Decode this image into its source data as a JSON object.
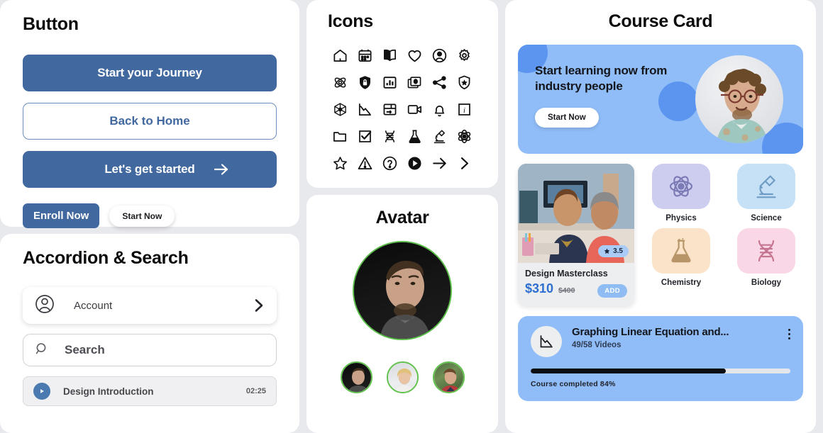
{
  "sections": {
    "button": {
      "title": "Button"
    },
    "icons": {
      "title": "Icons"
    },
    "avatar": {
      "title": "Avatar"
    },
    "accordion": {
      "title": "Accordion & Search"
    },
    "course": {
      "title": "Course Card"
    }
  },
  "buttons": {
    "primary": "Start your Journey",
    "outline": "Back to Home",
    "arrow": "Let's get started",
    "enroll": "Enroll Now",
    "start_now": "Start Now"
  },
  "accordion": {
    "account_label": "Account",
    "search_placeholder": "Search",
    "lesson_title": "Design Introduction",
    "lesson_time": "02:25"
  },
  "icon_names": [
    "home-icon",
    "calendar-icon",
    "book-icon",
    "heart-icon",
    "user-circle-icon",
    "gear-icon",
    "atom-icon",
    "shield-lock-icon",
    "bar-chart-icon",
    "card-stack-icon",
    "share-icon",
    "shield-star-icon",
    "network-node-icon",
    "line-chart-down-icon",
    "layout-arrow-icon",
    "video-camera-icon",
    "bell-icon",
    "info-icon",
    "folder-icon",
    "checkbox-checked-icon",
    "dna-icon",
    "flask-icon",
    "microscope-icon",
    "atom-orbit-icon",
    "star-icon",
    "warning-icon",
    "question-circle-icon",
    "play-circle-icon",
    "arrow-right-icon",
    "chevron-right-icon"
  ],
  "course": {
    "hero": {
      "title": "Start learning now from industry people",
      "cta": "Start Now"
    },
    "product": {
      "name": "Design Masterclass",
      "price": "$310",
      "old_price": "$400",
      "rating": "3.5",
      "add_label": "ADD"
    },
    "subjects": [
      {
        "label": "Physics",
        "icon": "atom-icon",
        "bg": "#cdcdf0",
        "stroke": "#7b7bb5"
      },
      {
        "label": "Science",
        "icon": "microscope-icon",
        "bg": "#c6e1f6",
        "stroke": "#6f9cc4"
      },
      {
        "label": "Chemistry",
        "icon": "flask-icon",
        "bg": "#fae3c8",
        "stroke": "#b79568"
      },
      {
        "label": "Biology",
        "icon": "dna-icon",
        "bg": "#fad7e6",
        "stroke": "#c4748f"
      }
    ],
    "progress": {
      "title": "Graphing Linear Equation and...",
      "videos": "49/58 Videos",
      "caption": "Course completed 84%",
      "percent": 75
    }
  },
  "colors": {
    "primary_blue": "#41689f",
    "hero_blue": "#90bdf8",
    "blob_blue": "#5b95f0",
    "page_bg": "#e8e9ed",
    "price_blue": "#2f6fd0"
  }
}
